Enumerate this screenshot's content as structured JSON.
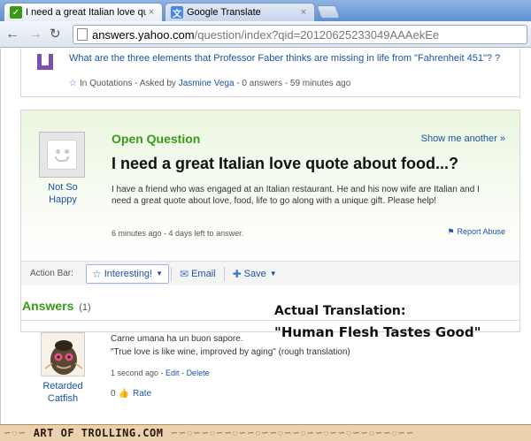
{
  "browser": {
    "tabs": [
      {
        "title": "I need a great Italian love qu",
        "favicon": "yahoo-answers-icon",
        "favicon_color": "#3a9a17"
      },
      {
        "title": "Google Translate",
        "favicon": "google-translate-icon",
        "favicon_color": "#4a86e8"
      }
    ],
    "close_glyph": "×",
    "url_host": "answers.yahoo.com",
    "url_path": "/question/index?qid=20120625233049AAAekEe"
  },
  "previous_question": {
    "text": "What are the three elements that Professor Faber thinks are missing in life from \"Fahrenheit 451\"? ?",
    "meta_prefix": "In Quotations - Asked by ",
    "asker": "Jasmine Vega",
    "meta_suffix": " - 0 answers - 59 minutes ago"
  },
  "question": {
    "status": "Open Question",
    "show_another": "Show me another »",
    "title": "I need a great Italian love quote about food...?",
    "body": "I have a friend who was engaged at an Italian restaurant. He and his now wife are Italian and I need a great quote about love, food, life to go along with a unique gift. Please help!",
    "meta": "6 minutes ago - 4 days left to answer.",
    "report": "Report Abuse",
    "asker": "Not So Happy"
  },
  "action_bar": {
    "label": "Action Bar:",
    "interesting": "Interesting!",
    "email": "Email",
    "save": "Save"
  },
  "answers": {
    "heading": "Answers",
    "count": "(1)",
    "items": [
      {
        "user": "Retarded Catfish",
        "line1": "Carne umana ha un buon sapore.",
        "line2": "\"True love is like wine, improved by aging\" (rough translation)",
        "meta_time": "1 second ago - ",
        "edit": "Edit",
        "meta_sep": " - ",
        "delete": "Delete",
        "rate_count": "0",
        "rate": "Rate"
      }
    ]
  },
  "annotation": {
    "label": "Actual Translation:",
    "text": "\"Human Flesh Tastes Good\""
  },
  "footer": {
    "brand": "ART OF TROLLING.COM"
  },
  "colors": {
    "link": "#1b52a6",
    "green": "#3a9a17"
  }
}
